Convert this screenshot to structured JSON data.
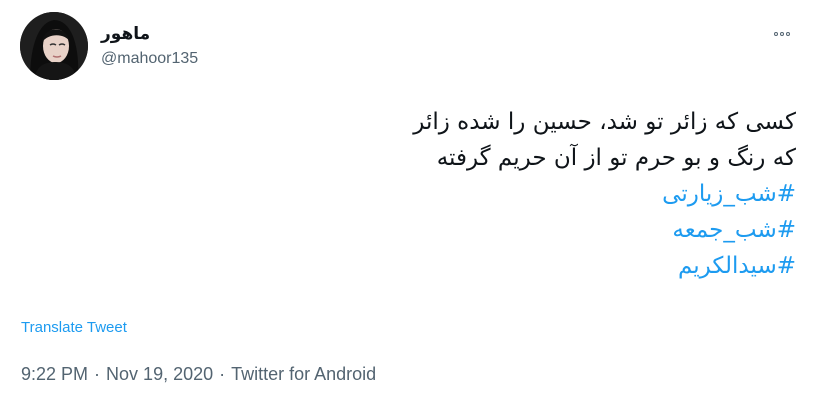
{
  "author": {
    "display_name": "ماهور",
    "handle": "@mahoor135",
    "avatar_icon": "avatar-photo"
  },
  "more_icon": "more-options-icon",
  "tweet": {
    "lines": [
      "کسی که زائر تو شد، حسین را شده زائر",
      "که رنگ و بو حرم تو از آن حریم گرفته"
    ],
    "hashtags": [
      "#شب_زیارتی",
      "#شب_جمعه",
      "#سیدالکریم"
    ]
  },
  "translate_label": "Translate Tweet",
  "meta": {
    "time": "9:22 PM",
    "separator": "·",
    "date": "Nov 19, 2020",
    "source": "Twitter for Android"
  },
  "colors": {
    "link": "#1d9bf0",
    "secondary_text": "#536471",
    "primary_text": "#0f1419"
  }
}
